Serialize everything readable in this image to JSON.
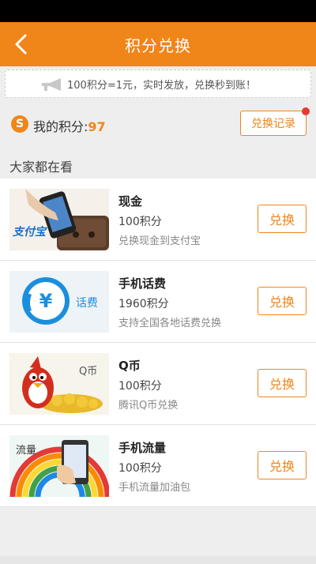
{
  "colors": {
    "accent": "#f08519",
    "background": "#eeeeee",
    "badge": "#e53935"
  },
  "nav": {
    "title": "积分兑换",
    "back_icon": "chevron-left-icon"
  },
  "notice": {
    "text": "100积分=1元，实时发放，兑换秒到账！",
    "icon": "megaphone-icon"
  },
  "points": {
    "label": "我的积分:",
    "value": "97",
    "record_label": "兑换记录"
  },
  "section": {
    "title": "大家都在看"
  },
  "items": [
    {
      "name": "现金",
      "cost": "100积分",
      "desc": "兑换现金到支付宝",
      "button": "兑换",
      "thumb_text": "支付宝"
    },
    {
      "name": "手机话费",
      "cost": "1960积分",
      "desc": "支持全国各地话费兑换",
      "button": "兑换",
      "thumb_text": "话费"
    },
    {
      "name": "Q币",
      "cost": "100积分",
      "desc": "腾讯Q币兑换",
      "button": "兑换",
      "thumb_text": "Q币"
    },
    {
      "name": "手机流量",
      "cost": "100积分",
      "desc": "手机流量加油包",
      "button": "兑换",
      "thumb_text": "流量"
    }
  ]
}
